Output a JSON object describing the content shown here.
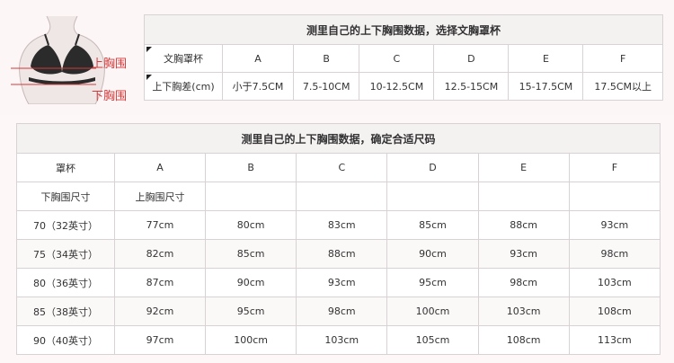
{
  "diagram": {
    "upper_label": "上胸围",
    "lower_label": "下胸围"
  },
  "table1": {
    "title": "测里自己的上下胸围数据，选择文胸罩杯",
    "row1_head": "文胸罩杯",
    "row2_head": "上下胸差(cm)",
    "cups": [
      "A",
      "B",
      "C",
      "D",
      "E",
      "F"
    ],
    "diffs": [
      "小于7.5CM",
      "7.5-10CM",
      "10-12.5CM",
      "12.5-15CM",
      "15-17.5CM",
      "17.5CM以上"
    ]
  },
  "table2": {
    "title": "测里自己的上下胸围数据，确定合适尺码",
    "cup_head": "罩杯",
    "under_head": "下胸围尺寸",
    "upper_head": "上胸围尺寸",
    "cups": [
      "A",
      "B",
      "C",
      "D",
      "E",
      "F"
    ],
    "rows": [
      {
        "size": "70（32英寸）",
        "values": [
          "77cm",
          "80cm",
          "83cm",
          "85cm",
          "88cm",
          "93cm"
        ]
      },
      {
        "size": "75（34英寸）",
        "values": [
          "82cm",
          "85cm",
          "88cm",
          "90cm",
          "93cm",
          "98cm"
        ]
      },
      {
        "size": "80（36英寸）",
        "values": [
          "87cm",
          "90cm",
          "93cm",
          "95cm",
          "98cm",
          "103cm"
        ]
      },
      {
        "size": "85（38英寸）",
        "values": [
          "92cm",
          "95cm",
          "98cm",
          "100cm",
          "103cm",
          "108cm"
        ]
      },
      {
        "size": "90（40英寸）",
        "values": [
          "97cm",
          "100cm",
          "103cm",
          "105cm",
          "108cm",
          "113cm"
        ]
      }
    ]
  }
}
